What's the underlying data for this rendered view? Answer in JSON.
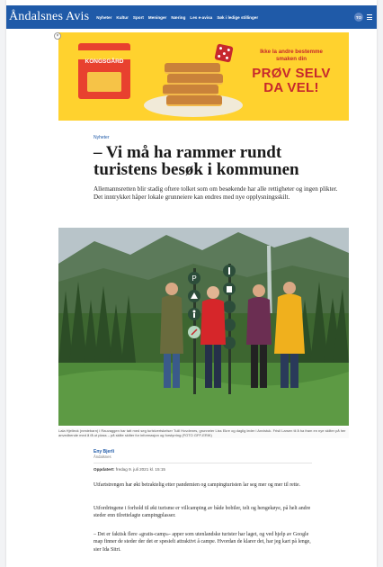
{
  "nav": {
    "brand": "Åndalsnes Avis",
    "links": [
      "Nyheter",
      "Kultur",
      "Sport",
      "Meninger",
      "Næring",
      "Les e-avisa",
      "Søk i ledige stillinger"
    ],
    "user_initials": "TO"
  },
  "ad": {
    "close": "×",
    "brand": "KONGSGÅRD",
    "tagline": "Ikke la andre bestemme smaken din",
    "cta": "PRØV SELV DA VEL!"
  },
  "article": {
    "section": "Nyheter",
    "headline": "– Vi må ha rammer rundt turistens besøk i kommunen",
    "lead": "Allemannsretten blir stadig oftere tolket som om besøkende har alle rettigheter og ingen plikter. Det inntrykket håper lokale grunneiere kan endres med nye opplysningsskilt.",
    "caption": "Lala Hjelleck (nestebarn) i Rauvaggen har tatt med seg turistvertskelser Tulil Hovdenes, grunneier Liss Ekre og daglig leder i Anvistuk. Frisil Larsen til å ha fram en nye skilter på her anvedbende med å få ut plass – på skilte skilter for informasjon og forstyrring (FOTO GFF-ERIK)",
    "author_name": "Eny Bjerli",
    "author_role": "Åndalsnes",
    "published_label": "Oppdatert:",
    "published_value": "fredag 9. juli 2021 kl. 15:15",
    "paragraphs": [
      "Utfartstrengen har økt betraktelig etter pandemien og campingturisten lar seg mer og mer til rette.",
      "Utfordringene i forhold til økt turisme er villcamping av både bobiler, telt og hengekøye, på helt andre steder enn tilrettelagte campingplasser.",
      "– Det er faktisk flere «gratis-camp»- apper som utenlandske turister har laget, og ved hjelp av Google map finner de steder der det er spesielt attraktivt å campe. Hvordan de klarer det, har jeg kart på lenge, sier Ida Sitri."
    ]
  },
  "colors": {
    "nav_blue": "#1f5aa8",
    "ad_yellow": "#ffd22e",
    "ad_red": "#c7282d"
  },
  "icons": {
    "signs": [
      "parking-icon",
      "camping-icon",
      "hiking-icon",
      "no-fire-icon",
      "info-icon",
      "trash-icon"
    ]
  }
}
